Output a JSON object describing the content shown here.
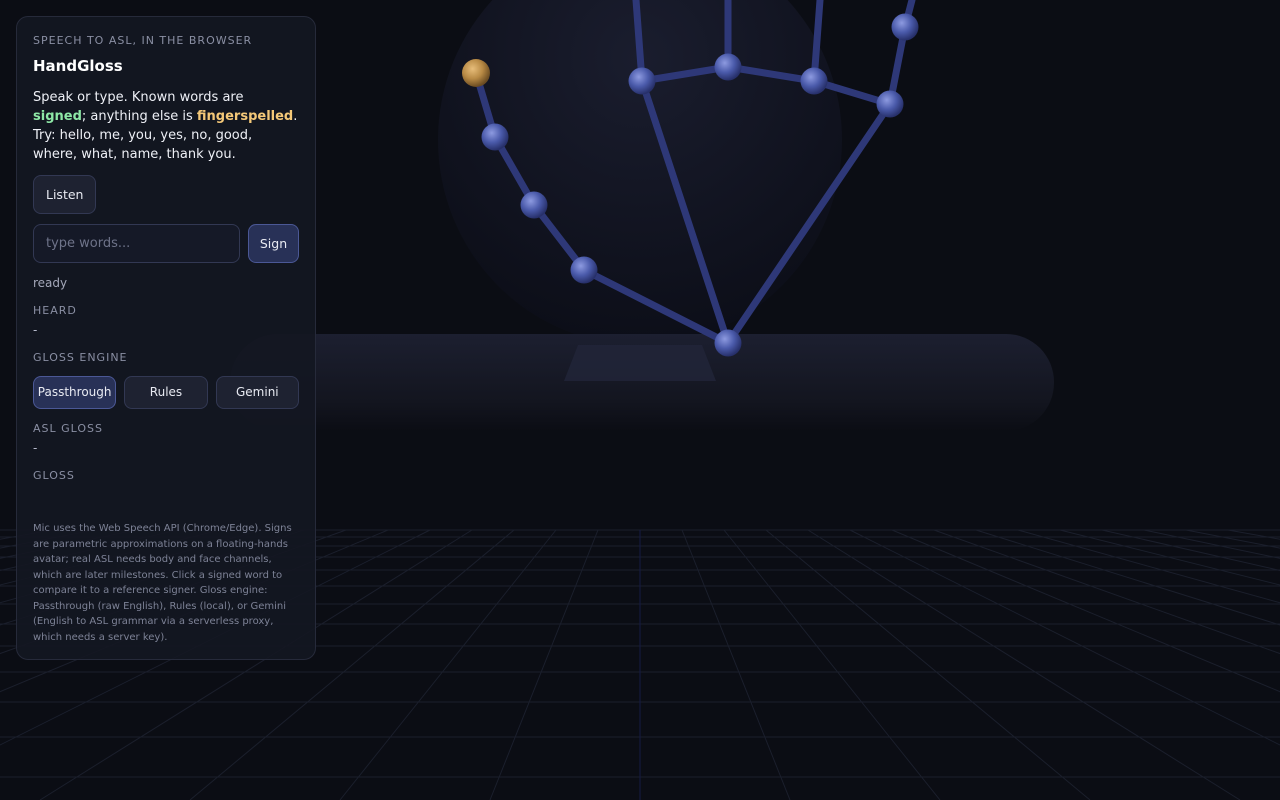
{
  "panel": {
    "eyebrow": "SPEECH TO ASL, IN THE BROWSER",
    "title": "HandGloss",
    "intro": {
      "part1": "Speak or type. Known words are ",
      "signed": "signed",
      "part2": "; anything else is ",
      "fingerspelled": "fingerspelled",
      "part3": ". Try: hello, me, you, yes, no, good, where, what, name, thank you."
    },
    "listen_label": "Listen",
    "input": {
      "value": "",
      "placeholder": "type words..."
    },
    "sign_label": "Sign",
    "status": "ready",
    "heard": {
      "label": "HEARD",
      "value": "-"
    },
    "engine": {
      "label": "GLOSS ENGINE",
      "options": [
        "Passthrough",
        "Rules",
        "Gemini"
      ],
      "selected": "Passthrough"
    },
    "asl_gloss": {
      "label": "ASL GLOSS",
      "value": "-"
    },
    "gloss": {
      "label": "GLOSS",
      "value": ""
    },
    "footnote": "Mic uses the Web Speech API (Chrome/Edge). Signs are parametric approximations on a floating-hands avatar; real ASL needs body and face channels, which are later milestones. Click a signed word to compare it to a reference signer. Gloss engine: Passthrough (raw English), Rules (local), or Gemini (English to ASL grammar via a serverless proxy, which needs a server key)."
  },
  "colors": {
    "background": "#0b0d14",
    "joint": "#4a5aaa",
    "bone": "#2e3878",
    "thumb_tip": "#b88a45",
    "signed_highlight": "#8ee8a6",
    "fingerspelled_highlight": "#f4c878"
  }
}
